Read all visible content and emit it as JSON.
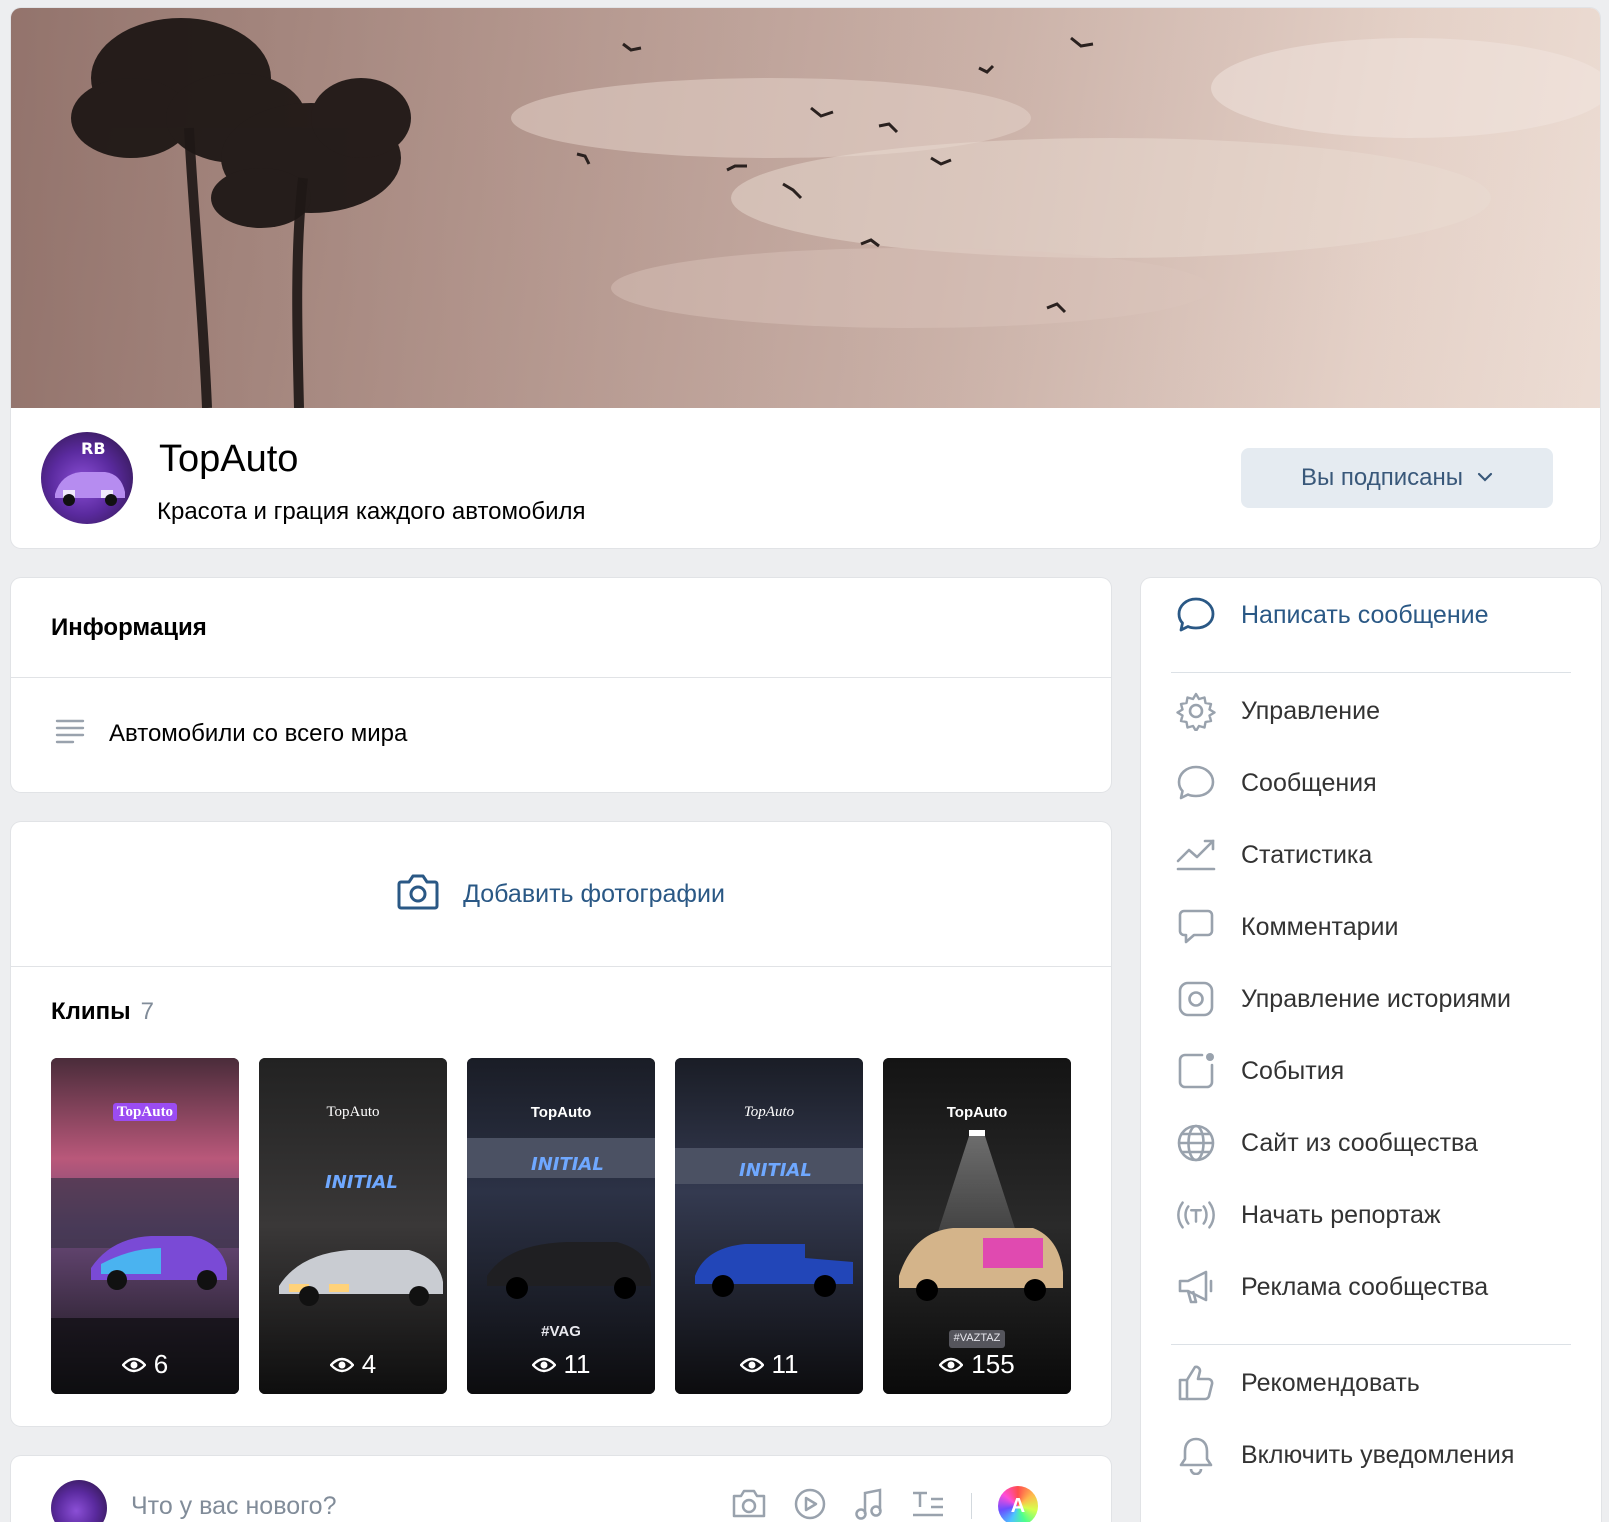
{
  "group": {
    "name": "TopAuto",
    "status": "Красота и грация каждого автомобиля",
    "subscribe_label": "Вы подписаны"
  },
  "info": {
    "title": "Информация",
    "description": "Автомобили со всего мира"
  },
  "media": {
    "add_photos_label": "Добавить фотографии",
    "clips_title": "Клипы",
    "clips_count": "7",
    "clips": [
      {
        "brand": "TopAuto",
        "tag": "",
        "views": "6"
      },
      {
        "brand": "TopAuto",
        "tag": "",
        "views": "4"
      },
      {
        "brand": "TopAuto",
        "tag": "#VAG",
        "views": "11"
      },
      {
        "brand": "TopAuto",
        "tag": "",
        "views": "11"
      },
      {
        "brand": "TopAuto",
        "tag": "#VAZTAZ",
        "views": "155"
      }
    ]
  },
  "composer": {
    "placeholder": "Что у вас нового?",
    "ai_letter": "A"
  },
  "menu": {
    "items": [
      {
        "label": "Написать сообщение",
        "icon": "message-icon"
      },
      {
        "label": "Управление",
        "icon": "gear-icon"
      },
      {
        "label": "Сообщения",
        "icon": "chat-icon"
      },
      {
        "label": "Статистика",
        "icon": "chart-icon"
      },
      {
        "label": "Комментарии",
        "icon": "comment-icon"
      },
      {
        "label": "Управление историями",
        "icon": "stories-icon"
      },
      {
        "label": "События",
        "icon": "events-icon"
      },
      {
        "label": "Сайт из сообщества",
        "icon": "globe-icon"
      },
      {
        "label": "Начать репортаж",
        "icon": "broadcast-icon"
      },
      {
        "label": "Реклама сообщества",
        "icon": "megaphone-icon"
      },
      {
        "label": "Рекомендовать",
        "icon": "thumb-up-icon"
      },
      {
        "label": "Включить уведомления",
        "icon": "bell-icon"
      }
    ]
  },
  "colors": {
    "accent": "#2a5885",
    "background": "#edeef0",
    "secondary_text": "#818c99"
  }
}
